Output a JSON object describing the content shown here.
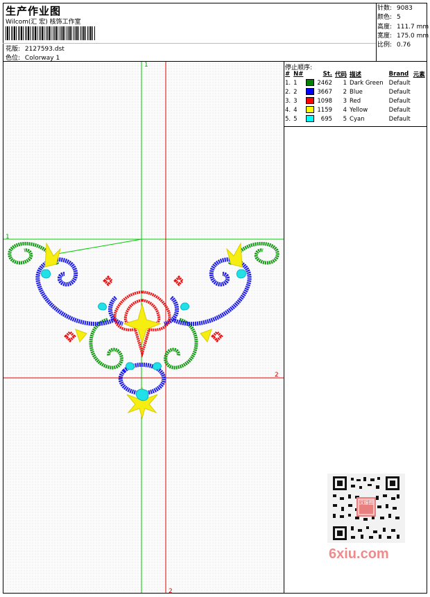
{
  "header": {
    "title": "生产作业图",
    "company": "Wilcom(汇 宏) 核饰工作室",
    "design_label": "花版:",
    "design_value": "2127593.dst",
    "color_label": "色位:",
    "color_value": "Colorway 1"
  },
  "stats": [
    {
      "label": "针数:",
      "value": "9083"
    },
    {
      "label": "颜色:",
      "value": "5"
    },
    {
      "label": "高度:",
      "value": "111.7 mm"
    },
    {
      "label": "宽度:",
      "value": "175.0 mm"
    },
    {
      "label": "比例:",
      "value": "0.76"
    }
  ],
  "stop_sequence": {
    "title": "停止顺序:",
    "headers": [
      "#",
      "N#",
      "St.",
      "代码",
      "描述",
      "Brand",
      "元素"
    ],
    "rows": [
      {
        "idx": "1.",
        "n": "1",
        "color": "#008000",
        "st": "2462",
        "code": "1",
        "desc": "Dark Green",
        "brand": "Default"
      },
      {
        "idx": "2.",
        "n": "2",
        "color": "#0000ff",
        "st": "3667",
        "code": "2",
        "desc": "Blue",
        "brand": "Default"
      },
      {
        "idx": "3.",
        "n": "3",
        "color": "#ff0000",
        "st": "1098",
        "code": "3",
        "desc": "Red",
        "brand": "Default"
      },
      {
        "idx": "4.",
        "n": "4",
        "color": "#ffff00",
        "st": "1159",
        "code": "4",
        "desc": "Yellow",
        "brand": "Default"
      },
      {
        "idx": "5.",
        "n": "5",
        "color": "#00ffff",
        "st": "695",
        "code": "5",
        "desc": "Cyan",
        "brand": "Default"
      }
    ]
  },
  "canvas": {
    "guide_labels": {
      "green_v": "1",
      "green_h": "1",
      "red_h": "2",
      "red_v": "2"
    },
    "colors": {
      "green_guide": "#00cc00",
      "red_guide": "#e00000"
    }
  },
  "watermark": {
    "text": "6xiu.com",
    "seal": "汉服图"
  }
}
